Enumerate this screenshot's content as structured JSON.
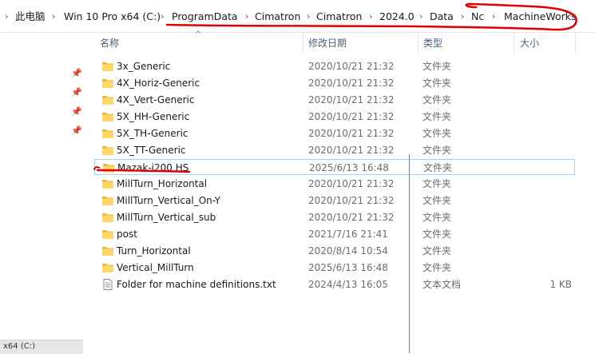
{
  "breadcrumb": [
    "此电脑",
    "Win 10 Pro x64 (C:)",
    "ProgramData",
    "Cimatron",
    "Cimatron",
    "2024.0",
    "Data",
    "Nc",
    "MachineWorks"
  ],
  "columns": {
    "name": "名称",
    "date": "修改日期",
    "type": "类型",
    "size": "大小"
  },
  "nav_bottom_label": "x64 (C:)",
  "files": [
    {
      "name": "3x_Generic",
      "date": "2020/10/21 21:32",
      "type": "文件夹",
      "size": "",
      "icon": "folder-icon"
    },
    {
      "name": "4X_Horiz-Generic",
      "date": "2020/10/21 21:32",
      "type": "文件夹",
      "size": "",
      "icon": "folder-icon"
    },
    {
      "name": "4X_Vert-Generic",
      "date": "2020/10/21 21:32",
      "type": "文件夹",
      "size": "",
      "icon": "folder-icon"
    },
    {
      "name": "5X_HH-Generic",
      "date": "2020/10/21 21:32",
      "type": "文件夹",
      "size": "",
      "icon": "folder-icon"
    },
    {
      "name": "5X_TH-Generic",
      "date": "2020/10/21 21:32",
      "type": "文件夹",
      "size": "",
      "icon": "folder-icon"
    },
    {
      "name": "5X_TT-Generic",
      "date": "2020/10/21 21:32",
      "type": "文件夹",
      "size": "",
      "icon": "folder-icon"
    },
    {
      "name": "Mazak-i200 HS",
      "date": "2025/6/13 16:48",
      "type": "文件夹",
      "size": "",
      "icon": "folder-icon"
    },
    {
      "name": "MillTurn_Horizontal",
      "date": "2020/10/21 21:32",
      "type": "文件夹",
      "size": "",
      "icon": "folder-icon"
    },
    {
      "name": "MillTurn_Vertical_On-Y",
      "date": "2020/10/21 21:32",
      "type": "文件夹",
      "size": "",
      "icon": "folder-icon"
    },
    {
      "name": "MillTurn_Vertical_sub",
      "date": "2020/10/21 21:32",
      "type": "文件夹",
      "size": "",
      "icon": "folder-icon"
    },
    {
      "name": "post",
      "date": "2021/7/16 21:41",
      "type": "文件夹",
      "size": "",
      "icon": "folder-icon"
    },
    {
      "name": "Turn_Horizontal",
      "date": "2020/8/14 10:54",
      "type": "文件夹",
      "size": "",
      "icon": "folder-icon"
    },
    {
      "name": "Vertical_MillTurn",
      "date": "2025/6/13 16:48",
      "type": "文件夹",
      "size": "",
      "icon": "folder-icon"
    },
    {
      "name": "Folder for machine definitions.txt",
      "date": "2024/4/13 16:05",
      "type": "文本文档",
      "size": "1 KB",
      "icon": "text-file-icon"
    }
  ],
  "colors": {
    "folder": "#ffd766",
    "folder_dark": "#e8b73c",
    "selection_border": "#99d1ff",
    "annotation_red": "#e10000",
    "header_text": "#4c607a"
  }
}
